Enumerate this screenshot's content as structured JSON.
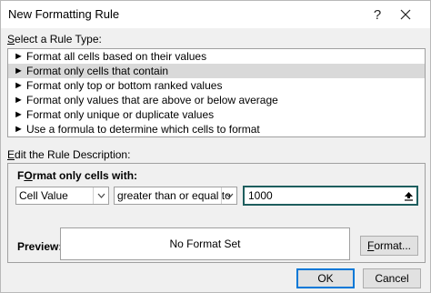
{
  "window": {
    "title": "New Formatting Rule",
    "help_label": "?",
    "close_label": "✕"
  },
  "rule_type": {
    "label_prefix": "",
    "label_accel": "S",
    "label_rest": "elect a Rule Type:",
    "items": [
      {
        "label": "Format all cells based on their values",
        "selected": false
      },
      {
        "label": "Format only cells that contain",
        "selected": true
      },
      {
        "label": "Format only top or bottom ranked values",
        "selected": false
      },
      {
        "label": "Format only values that are above or below average",
        "selected": false
      },
      {
        "label": "Format only unique or duplicate values",
        "selected": false
      },
      {
        "label": "Use a formula to determine which cells to format",
        "selected": false
      }
    ],
    "item_arrow": "►"
  },
  "description": {
    "label_accel": "E",
    "label_rest": "dit the Rule Description:",
    "format_label_accel": "O",
    "format_label_prefix": "F",
    "format_label_rest": "rmat only cells with:",
    "condition_type": "Cell Value",
    "operator": "greater than or equal to",
    "value": "1000",
    "preview_label": "Preview:",
    "preview_text": "No Format Set",
    "format_button_accel": "F",
    "format_button_rest": "ormat..."
  },
  "footer": {
    "ok_label": "OK",
    "cancel_label": "Cancel"
  }
}
